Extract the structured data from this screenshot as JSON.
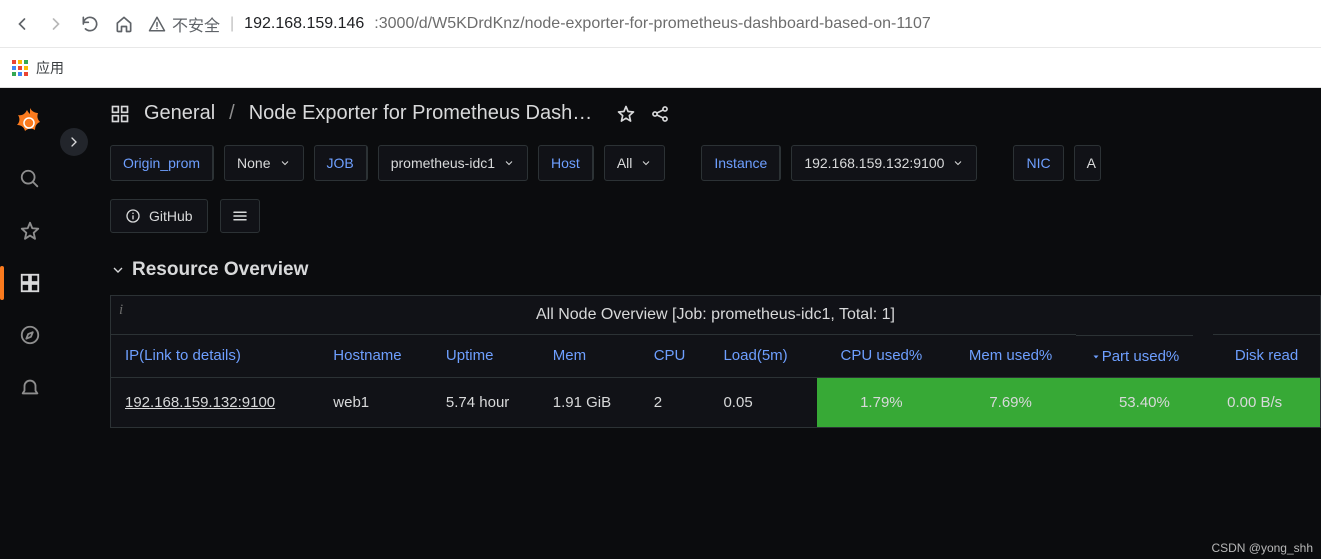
{
  "browser": {
    "insecure_label": "不安全",
    "url_host": "192.168.159.146",
    "url_port_path": ":3000/d/W5KDrdKnz/node-exporter-for-prometheus-dashboard-based-on-1107",
    "apps_label": "应用"
  },
  "breadcrumb": {
    "folder": "General",
    "dash": "Node Exporter for Prometheus Dash…"
  },
  "vars": {
    "origin_label": "Origin_prom",
    "origin_value": "None",
    "job_label": "JOB",
    "job_value": "prometheus-idc1",
    "host_label": "Host",
    "host_value": "All",
    "instance_label": "Instance",
    "instance_value": "192.168.159.132:9100",
    "nic_label": "NIC",
    "extra_label": "A"
  },
  "buttons": {
    "github": "GitHub"
  },
  "row_title": "Resource Overview",
  "panel_title": "All Node Overview [Job: prometheus-idc1, Total: 1]",
  "columns": {
    "ip": "IP(Link to details)",
    "hostname": "Hostname",
    "uptime": "Uptime",
    "mem": "Mem",
    "cpu": "CPU",
    "load": "Load(5m)",
    "cpu_used": "CPU used%",
    "mem_used": "Mem used%",
    "part_used": "Part used%",
    "disk_read": "Disk read"
  },
  "row": {
    "ip": "192.168.159.132:9100",
    "hostname": "web1",
    "uptime": "5.74 hour",
    "mem": "1.91 GiB",
    "cpu": "2",
    "load": "0.05",
    "cpu_used": "1.79%",
    "mem_used": "7.69%",
    "part_used": "53.40%",
    "disk_read": "0.00 B/s"
  },
  "watermark": "CSDN @yong_shh"
}
